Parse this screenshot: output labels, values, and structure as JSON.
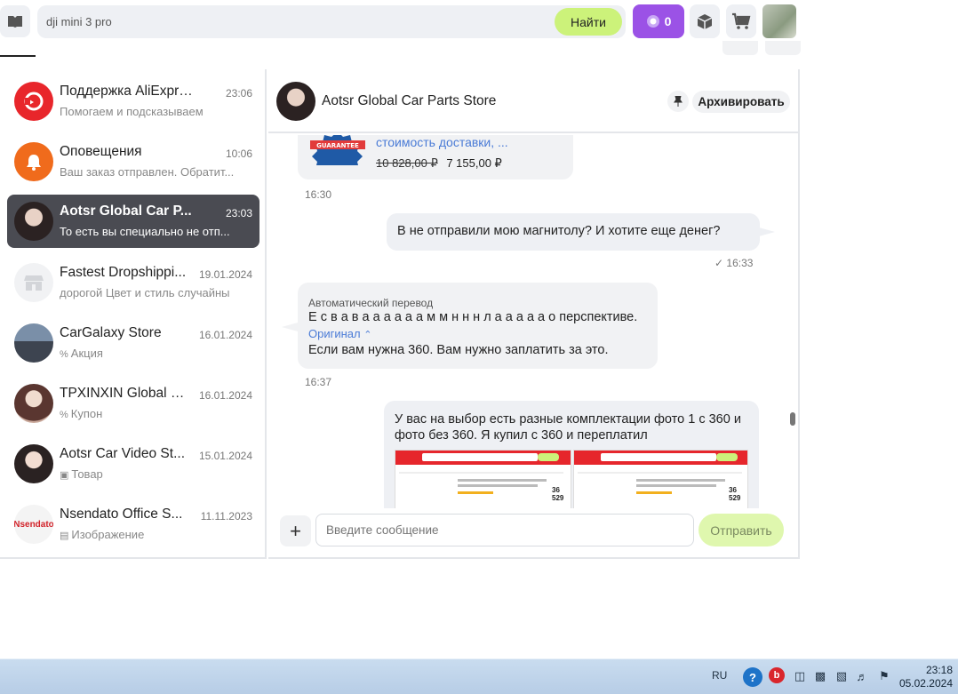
{
  "colors": {
    "accent_green": "#ccf27a",
    "accent_purple": "#9b52e6",
    "active_chat": "#4a4b52",
    "bubble": "#f1f2f4",
    "link": "#4a7bd6"
  },
  "search": {
    "value": "dji mini 3 pro",
    "button": "Найти"
  },
  "coins": {
    "count": "0",
    "icon": "coin-icon"
  },
  "chats": [
    {
      "name": "Поддержка AliExpress",
      "time": "23:06",
      "preview": "Помогаем и подсказываем",
      "icon": "support-icon"
    },
    {
      "name": "Оповещения",
      "time": "10:06",
      "preview": "Ваш заказ отправлен. Обратит...",
      "icon": "bell-icon"
    },
    {
      "name": "Aotsr Global Car P...",
      "time": "23:03",
      "preview": "То есть вы специально не отп...",
      "active": true
    },
    {
      "name": "Fastest Dropshippi...",
      "time": "19.01.2024",
      "preview": "дорогой Цвет и стиль случайны",
      "icon": "shop-icon"
    },
    {
      "name": "CarGalaxy Store",
      "time": "16.01.2024",
      "preview": "Акция",
      "preview_icon": "percent-icon"
    },
    {
      "name": "TPXINXIN Global St...",
      "time": "16.01.2024",
      "preview": "Купон",
      "preview_icon": "percent-icon"
    },
    {
      "name": "Aotsr Car Video St...",
      "time": "15.01.2024",
      "preview": "Товар",
      "preview_icon": "box-icon"
    },
    {
      "name": "Nsendato Office S...",
      "time": "11.11.2023",
      "preview": "Изображение",
      "preview_icon": "image-icon",
      "logo_text": "Nsendato"
    }
  ],
  "conversation": {
    "title": "Aotsr Global Car Parts Store",
    "archive_label": "Архивировать",
    "product": {
      "badge_text": "GUARANTEE",
      "link_text": "стоимость доставки, ...",
      "old_price": "10 828,00 ₽",
      "price": "7 155,00 ₽",
      "time": "16:30"
    },
    "msg_out_1": {
      "text": "В не отправили мою магнитолу? И хотите еще денег?",
      "time": "16:33"
    },
    "msg_in_translated": {
      "label": "Автоматический перевод",
      "original_text": "Е с в а в а а а а а а м м н н н л а а а а а о перспективе.",
      "toggle": "Оригинал",
      "text": "Если вам нужна 360. Вам нужно заплатить за это.",
      "time": "16:37"
    },
    "msg_out_2": {
      "text": "У вас на выбор есть разные комплектации фото 1 с 360 и фото без 360. Я купил с 360 и переплатил"
    },
    "screenshot_price": "36 529"
  },
  "composer": {
    "placeholder": "Введите сообщение",
    "send": "Отправить"
  },
  "taskbar": {
    "lang": "RU",
    "time": "23:18",
    "date": "05.02.2024"
  }
}
